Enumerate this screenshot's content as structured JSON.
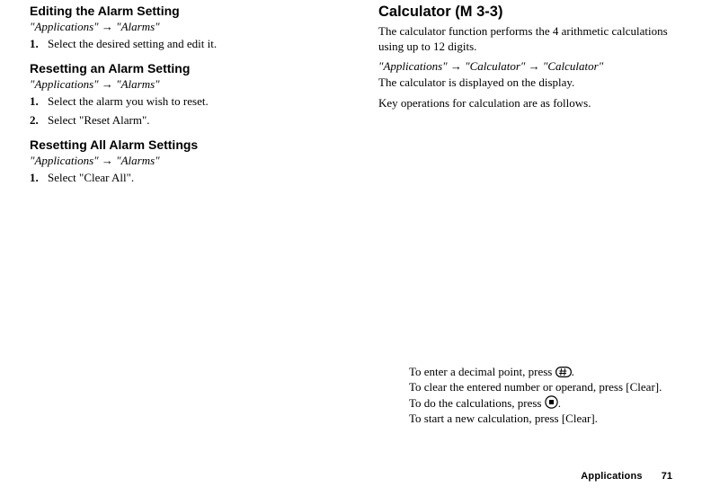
{
  "left": {
    "sec1": {
      "heading": "Editing the Alarm Setting",
      "nav_parts": [
        "\"Applications\"",
        "\"Alarms\""
      ],
      "steps": [
        {
          "n": "1.",
          "t": "Select the desired setting and edit it."
        }
      ]
    },
    "sec2": {
      "heading": "Resetting an Alarm Setting",
      "nav_parts": [
        "\"Applications\"",
        "\"Alarms\""
      ],
      "steps": [
        {
          "n": "1.",
          "t": "Select the alarm you wish to reset."
        },
        {
          "n": "2.",
          "t": "Select \"Reset Alarm\"."
        }
      ]
    },
    "sec3": {
      "heading": "Resetting All Alarm Settings",
      "nav_parts": [
        "\"Applications\"",
        "\"Alarms\""
      ],
      "steps": [
        {
          "n": "1.",
          "t": "Select \"Clear All\"."
        }
      ]
    }
  },
  "right": {
    "heading": "Calculator",
    "section_code": "(M 3-3)",
    "intro": "The calculator function performs the 4 arithmetic calculations using up to 12 digits.",
    "nav_parts": [
      "\"Applications\"",
      "\"Calculator\"",
      "\"Calculator\""
    ],
    "p2": "The calculator is displayed on the display.",
    "p3": "Key operations for calculation are as follows.",
    "instr": {
      "l1a": "To enter a decimal point, press ",
      "l1b": ".",
      "l2": "To clear the entered number or operand, press [Clear].",
      "l3a": "To do the calculations, press ",
      "l3b": ".",
      "l4": "To start a new calculation, press [Clear]."
    }
  },
  "footer": {
    "label": "Applications",
    "page": "71"
  },
  "arrow": "→"
}
